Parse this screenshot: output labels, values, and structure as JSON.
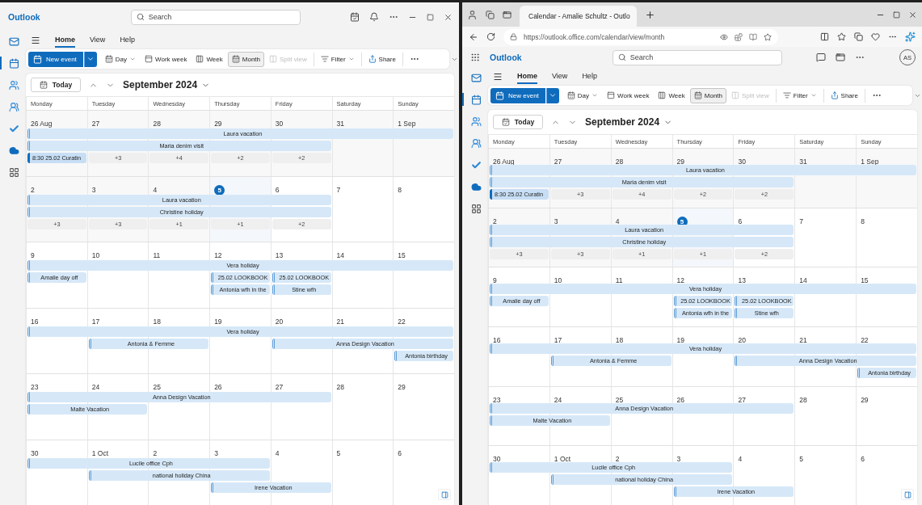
{
  "windows": [
    {
      "kind": "desktop",
      "app": "Outlook",
      "search": {
        "placeholder": "Search"
      },
      "rail": [
        {
          "kind": "mail",
          "selected": false
        },
        {
          "kind": "calendar",
          "selected": true
        },
        {
          "kind": "people",
          "selected": false
        },
        {
          "kind": "groups",
          "selected": false
        },
        {
          "kind": "todo",
          "selected": false
        },
        {
          "kind": "cloud",
          "selected": false
        },
        {
          "kind": "apps",
          "selected": false
        }
      ],
      "ribbon_tabs": [
        {
          "label": "Home",
          "selected": true
        },
        {
          "label": "View",
          "selected": false
        },
        {
          "label": "Help",
          "selected": false
        }
      ],
      "new_event": {
        "label": "New event"
      },
      "views": [
        {
          "kind": "day",
          "label": "Day",
          "selected": false
        },
        {
          "kind": "workweek",
          "label": "Work week",
          "selected": false
        },
        {
          "kind": "week",
          "label": "Week",
          "selected": false
        },
        {
          "kind": "month",
          "label": "Month",
          "selected": true
        }
      ],
      "actions": [
        {
          "kind": "split",
          "label": "Split view",
          "disabled": true
        },
        {
          "kind": "filter",
          "label": "Filter",
          "disabled": false
        },
        {
          "kind": "share",
          "label": "Share",
          "disabled": false
        }
      ],
      "calendar": {
        "today_button": "Today",
        "month": "September 2024",
        "weekdays": [
          "Monday",
          "Tuesday",
          "Wednesday",
          "Thursday",
          "Friday",
          "Saturday",
          "Sunday"
        ],
        "weeks": [
          {
            "days": [
              {
                "label": "26 Aug",
                "past": true,
                "today": false
              },
              {
                "label": "27",
                "past": true,
                "today": false
              },
              {
                "label": "28",
                "past": true,
                "today": false
              },
              {
                "label": "29",
                "past": true,
                "today": false
              },
              {
                "label": "30",
                "past": true,
                "today": false
              },
              {
                "label": "31",
                "past": true,
                "today": false
              },
              {
                "label": "1 Sep",
                "past": true,
                "today": false
              }
            ],
            "lanes": [
              [
                {
                  "kind": "allday",
                  "title": "Laura vacation"
                },
                {
                  "kind": "cont"
                },
                {
                  "kind": "cont"
                },
                {
                  "kind": "cont"
                },
                {
                  "kind": "cont"
                },
                {
                  "kind": "cont"
                },
                {
                  "kind": "cont"
                }
              ],
              [
                {
                  "kind": "allday",
                  "title": "Maria denim visit"
                },
                {
                  "kind": "cont"
                },
                {
                  "kind": "cont"
                },
                {
                  "kind": "cont"
                },
                {
                  "kind": "cont"
                }
              ],
              [
                {
                  "kind": "timed",
                  "title": "8:30 25.02 Curatin"
                },
                {
                  "kind": "more",
                  "title": "+3"
                },
                {
                  "kind": "more",
                  "title": "+4"
                },
                {
                  "kind": "more",
                  "title": "+2"
                },
                {
                  "kind": "more",
                  "title": "+2"
                }
              ]
            ]
          },
          {
            "days": [
              {
                "label": "2",
                "past": true,
                "today": false
              },
              {
                "label": "3",
                "past": true,
                "today": false
              },
              {
                "label": "4",
                "past": true,
                "today": false
              },
              {
                "label": "5",
                "past": false,
                "today": true
              },
              {
                "label": "6",
                "past": false,
                "today": false
              },
              {
                "label": "7",
                "past": false,
                "today": false
              },
              {
                "label": "8",
                "past": false,
                "today": false
              }
            ],
            "lanes": [
              [
                {
                  "kind": "allday",
                  "title": "Laura vacation"
                },
                {
                  "kind": "cont"
                },
                {
                  "kind": "cont"
                },
                {
                  "kind": "cont"
                },
                {
                  "kind": "cont"
                }
              ],
              [
                {
                  "kind": "allday",
                  "title": "Christine holiday"
                },
                {
                  "kind": "cont"
                },
                {
                  "kind": "cont"
                },
                {
                  "kind": "cont"
                },
                {
                  "kind": "cont"
                }
              ],
              [
                {
                  "kind": "more",
                  "title": "+3"
                },
                {
                  "kind": "more",
                  "title": "+3"
                },
                {
                  "kind": "more",
                  "title": "+1"
                },
                {
                  "kind": "more",
                  "title": "+1"
                },
                {
                  "kind": "more",
                  "title": "+2"
                }
              ]
            ]
          },
          {
            "days": [
              {
                "label": "9",
                "past": false,
                "today": false
              },
              {
                "label": "10",
                "past": false,
                "today": false
              },
              {
                "label": "11",
                "past": false,
                "today": false
              },
              {
                "label": "12",
                "past": false,
                "today": false
              },
              {
                "label": "13",
                "past": false,
                "today": false
              },
              {
                "label": "14",
                "past": false,
                "today": false
              },
              {
                "label": "15",
                "past": false,
                "today": false
              }
            ],
            "lanes": [
              [
                {
                  "kind": "allday",
                  "title": "Vera holiday"
                },
                {
                  "kind": "cont"
                },
                {
                  "kind": "cont"
                },
                {
                  "kind": "cont"
                },
                {
                  "kind": "cont"
                },
                {
                  "kind": "cont"
                },
                {
                  "kind": "cont"
                }
              ],
              [
                {
                  "kind": "allday",
                  "title": "Amalie day off"
                },
                {
                  "kind": "empty"
                },
                {
                  "kind": "empty"
                },
                {
                  "kind": "allday",
                  "title": "25.02 LOOKBOOK"
                },
                {
                  "kind": "allday",
                  "title": "25.02 LOOKBOOK"
                }
              ],
              [
                {
                  "kind": "empty"
                },
                {
                  "kind": "empty"
                },
                {
                  "kind": "empty"
                },
                {
                  "kind": "allday",
                  "title": "Antonia wfh in the"
                },
                {
                  "kind": "allday",
                  "title": "Stine wfh"
                }
              ]
            ]
          },
          {
            "days": [
              {
                "label": "16",
                "past": false,
                "today": false
              },
              {
                "label": "17",
                "past": false,
                "today": false
              },
              {
                "label": "18",
                "past": false,
                "today": false
              },
              {
                "label": "19",
                "past": false,
                "today": false
              },
              {
                "label": "20",
                "past": false,
                "today": false
              },
              {
                "label": "21",
                "past": false,
                "today": false
              },
              {
                "label": "22",
                "past": false,
                "today": false
              }
            ],
            "lanes": [
              [
                {
                  "kind": "allday",
                  "title": "Vera holiday"
                },
                {
                  "kind": "cont"
                },
                {
                  "kind": "cont"
                },
                {
                  "kind": "cont"
                },
                {
                  "kind": "cont"
                },
                {
                  "kind": "cont"
                },
                {
                  "kind": "cont"
                }
              ],
              [
                {
                  "kind": "empty"
                },
                {
                  "kind": "allday",
                  "title": "Antonia & Femme"
                },
                {
                  "kind": "cont"
                },
                {
                  "kind": "empty"
                },
                {
                  "kind": "allday",
                  "title": "Anna Design Vacation"
                },
                {
                  "kind": "cont"
                },
                {
                  "kind": "cont"
                }
              ],
              [
                {
                  "kind": "empty"
                },
                {
                  "kind": "empty"
                },
                {
                  "kind": "empty"
                },
                {
                  "kind": "empty"
                },
                {
                  "kind": "empty"
                },
                {
                  "kind": "empty"
                },
                {
                  "kind": "allday",
                  "title": "Antonia birthday"
                }
              ]
            ]
          },
          {
            "days": [
              {
                "label": "23",
                "past": false,
                "today": false
              },
              {
                "label": "24",
                "past": false,
                "today": false
              },
              {
                "label": "25",
                "past": false,
                "today": false
              },
              {
                "label": "26",
                "past": false,
                "today": false
              },
              {
                "label": "27",
                "past": false,
                "today": false
              },
              {
                "label": "28",
                "past": false,
                "today": false
              },
              {
                "label": "29",
                "past": false,
                "today": false
              }
            ],
            "lanes": [
              [
                {
                  "kind": "allday",
                  "title": "Anna Design Vacation"
                },
                {
                  "kind": "cont"
                },
                {
                  "kind": "cont"
                },
                {
                  "kind": "cont"
                },
                {
                  "kind": "cont"
                }
              ],
              [
                {
                  "kind": "allday",
                  "title": "Malte Vacation"
                },
                {
                  "kind": "cont"
                }
              ]
            ]
          },
          {
            "days": [
              {
                "label": "30",
                "past": false,
                "today": false
              },
              {
                "label": "1 Oct",
                "past": false,
                "today": false
              },
              {
                "label": "2",
                "past": false,
                "today": false
              },
              {
                "label": "3",
                "past": false,
                "today": false
              },
              {
                "label": "4",
                "past": false,
                "today": false
              },
              {
                "label": "5",
                "past": false,
                "today": false
              },
              {
                "label": "6",
                "past": false,
                "today": false
              }
            ],
            "lanes": [
              [
                {
                  "kind": "allday",
                  "title": "Lucile office Cph"
                },
                {
                  "kind": "cont"
                },
                {
                  "kind": "cont"
                },
                {
                  "kind": "cont"
                }
              ],
              [
                {
                  "kind": "empty"
                },
                {
                  "kind": "allday",
                  "title": "national holiday China"
                },
                {
                  "kind": "cont"
                },
                {
                  "kind": "cont"
                }
              ],
              [
                {
                  "kind": "empty"
                },
                {
                  "kind": "empty"
                },
                {
                  "kind": "empty"
                },
                {
                  "kind": "allday",
                  "title": "Irene Vacation"
                },
                {
                  "kind": "cont"
                }
              ]
            ]
          }
        ]
      }
    },
    {
      "kind": "browser",
      "browser_tab": {
        "title": "Calendar - Amalie Schultz - Outlo"
      },
      "address": "https://outlook.office.com/calendar/view/month",
      "app": "Outlook",
      "avatar": "AS",
      "search": {
        "placeholder": "Search"
      },
      "rail": [
        {
          "kind": "mail",
          "selected": false
        },
        {
          "kind": "calendar",
          "selected": true
        },
        {
          "kind": "people",
          "selected": false
        },
        {
          "kind": "groups",
          "selected": false
        },
        {
          "kind": "todo",
          "selected": false
        },
        {
          "kind": "cloud",
          "selected": false
        },
        {
          "kind": "apps",
          "selected": false
        }
      ],
      "ribbon_tabs": [
        {
          "label": "Home",
          "selected": true
        },
        {
          "label": "View",
          "selected": false
        },
        {
          "label": "Help",
          "selected": false
        }
      ],
      "new_event": {
        "label": "New event"
      },
      "views": [
        {
          "kind": "day",
          "label": "Day",
          "selected": false
        },
        {
          "kind": "workweek",
          "label": "Work week",
          "selected": false
        },
        {
          "kind": "week",
          "label": "Week",
          "selected": false
        },
        {
          "kind": "month",
          "label": "Month",
          "selected": true
        }
      ],
      "actions": [
        {
          "kind": "split",
          "label": "Split view",
          "disabled": true
        },
        {
          "kind": "filter",
          "label": "Filter",
          "disabled": false
        },
        {
          "kind": "share",
          "label": "Share",
          "disabled": false
        }
      ],
      "calendar": {
        "today_button": "Today",
        "month": "September 2024",
        "weekdays": [
          "Monday",
          "Tuesday",
          "Wednesday",
          "Thursday",
          "Friday",
          "Saturday",
          "Sunday"
        ],
        "weeks": [
          {
            "days": [
              {
                "label": "26 Aug",
                "past": true,
                "today": false
              },
              {
                "label": "27",
                "past": true,
                "today": false
              },
              {
                "label": "28",
                "past": true,
                "today": false
              },
              {
                "label": "29",
                "past": true,
                "today": false
              },
              {
                "label": "30",
                "past": true,
                "today": false
              },
              {
                "label": "31",
                "past": true,
                "today": false
              },
              {
                "label": "1 Sep",
                "past": true,
                "today": false
              }
            ],
            "lanes": [
              [
                {
                  "kind": "allday",
                  "title": "Laura vacation"
                },
                {
                  "kind": "cont"
                },
                {
                  "kind": "cont"
                },
                {
                  "kind": "cont"
                },
                {
                  "kind": "cont"
                },
                {
                  "kind": "cont"
                },
                {
                  "kind": "cont"
                }
              ],
              [
                {
                  "kind": "allday",
                  "title": "Maria denim visit"
                },
                {
                  "kind": "cont"
                },
                {
                  "kind": "cont"
                },
                {
                  "kind": "cont"
                },
                {
                  "kind": "cont"
                }
              ],
              [
                {
                  "kind": "timed",
                  "title": "8:30 25.02 Curatin"
                },
                {
                  "kind": "more",
                  "title": "+3"
                },
                {
                  "kind": "more",
                  "title": "+4"
                },
                {
                  "kind": "more",
                  "title": "+2"
                },
                {
                  "kind": "more",
                  "title": "+2"
                }
              ]
            ]
          },
          {
            "days": [
              {
                "label": "2",
                "past": true,
                "today": false
              },
              {
                "label": "3",
                "past": true,
                "today": false
              },
              {
                "label": "4",
                "past": true,
                "today": false
              },
              {
                "label": "5",
                "past": false,
                "today": true
              },
              {
                "label": "6",
                "past": false,
                "today": false
              },
              {
                "label": "7",
                "past": false,
                "today": false
              },
              {
                "label": "8",
                "past": false,
                "today": false
              }
            ],
            "lanes": [
              [
                {
                  "kind": "allday",
                  "title": "Laura vacation"
                },
                {
                  "kind": "cont"
                },
                {
                  "kind": "cont"
                },
                {
                  "kind": "cont"
                },
                {
                  "kind": "cont"
                }
              ],
              [
                {
                  "kind": "allday",
                  "title": "Christine holiday"
                },
                {
                  "kind": "cont"
                },
                {
                  "kind": "cont"
                },
                {
                  "kind": "cont"
                },
                {
                  "kind": "cont"
                }
              ],
              [
                {
                  "kind": "more",
                  "title": "+3"
                },
                {
                  "kind": "more",
                  "title": "+3"
                },
                {
                  "kind": "more",
                  "title": "+1"
                },
                {
                  "kind": "more",
                  "title": "+1"
                },
                {
                  "kind": "more",
                  "title": "+2"
                }
              ]
            ]
          },
          {
            "days": [
              {
                "label": "9",
                "past": false,
                "today": false
              },
              {
                "label": "10",
                "past": false,
                "today": false
              },
              {
                "label": "11",
                "past": false,
                "today": false
              },
              {
                "label": "12",
                "past": false,
                "today": false
              },
              {
                "label": "13",
                "past": false,
                "today": false
              },
              {
                "label": "14",
                "past": false,
                "today": false
              },
              {
                "label": "15",
                "past": false,
                "today": false
              }
            ],
            "lanes": [
              [
                {
                  "kind": "allday",
                  "title": "Vera holiday"
                },
                {
                  "kind": "cont"
                },
                {
                  "kind": "cont"
                },
                {
                  "kind": "cont"
                },
                {
                  "kind": "cont"
                },
                {
                  "kind": "cont"
                },
                {
                  "kind": "cont"
                }
              ],
              [
                {
                  "kind": "allday",
                  "title": "Amalie day off"
                },
                {
                  "kind": "empty"
                },
                {
                  "kind": "empty"
                },
                {
                  "kind": "allday",
                  "title": "25.02 LOOKBOOK"
                },
                {
                  "kind": "allday",
                  "title": "25.02 LOOKBOOK"
                }
              ],
              [
                {
                  "kind": "empty"
                },
                {
                  "kind": "empty"
                },
                {
                  "kind": "empty"
                },
                {
                  "kind": "allday",
                  "title": "Antonia wfh in the"
                },
                {
                  "kind": "allday",
                  "title": "Stine wfh"
                }
              ]
            ]
          },
          {
            "days": [
              {
                "label": "16",
                "past": false,
                "today": false
              },
              {
                "label": "17",
                "past": false,
                "today": false
              },
              {
                "label": "18",
                "past": false,
                "today": false
              },
              {
                "label": "19",
                "past": false,
                "today": false
              },
              {
                "label": "20",
                "past": false,
                "today": false
              },
              {
                "label": "21",
                "past": false,
                "today": false
              },
              {
                "label": "22",
                "past": false,
                "today": false
              }
            ],
            "lanes": [
              [
                {
                  "kind": "allday",
                  "title": "Vera holiday"
                },
                {
                  "kind": "cont"
                },
                {
                  "kind": "cont"
                },
                {
                  "kind": "cont"
                },
                {
                  "kind": "cont"
                },
                {
                  "kind": "cont"
                },
                {
                  "kind": "cont"
                }
              ],
              [
                {
                  "kind": "empty"
                },
                {
                  "kind": "allday",
                  "title": "Antonia & Femme"
                },
                {
                  "kind": "cont"
                },
                {
                  "kind": "empty"
                },
                {
                  "kind": "allday",
                  "title": "Anna Design Vacation"
                },
                {
                  "kind": "cont"
                },
                {
                  "kind": "cont"
                }
              ],
              [
                {
                  "kind": "empty"
                },
                {
                  "kind": "empty"
                },
                {
                  "kind": "empty"
                },
                {
                  "kind": "empty"
                },
                {
                  "kind": "empty"
                },
                {
                  "kind": "empty"
                },
                {
                  "kind": "allday",
                  "title": "Antonia birthday"
                }
              ]
            ]
          },
          {
            "days": [
              {
                "label": "23",
                "past": false,
                "today": false
              },
              {
                "label": "24",
                "past": false,
                "today": false
              },
              {
                "label": "25",
                "past": false,
                "today": false
              },
              {
                "label": "26",
                "past": false,
                "today": false
              },
              {
                "label": "27",
                "past": false,
                "today": false
              },
              {
                "label": "28",
                "past": false,
                "today": false
              },
              {
                "label": "29",
                "past": false,
                "today": false
              }
            ],
            "lanes": [
              [
                {
                  "kind": "allday",
                  "title": "Anna Design Vacation"
                },
                {
                  "kind": "cont"
                },
                {
                  "kind": "cont"
                },
                {
                  "kind": "cont"
                },
                {
                  "kind": "cont"
                }
              ],
              [
                {
                  "kind": "allday",
                  "title": "Malte Vacation"
                },
                {
                  "kind": "cont"
                }
              ]
            ]
          },
          {
            "days": [
              {
                "label": "30",
                "past": false,
                "today": false
              },
              {
                "label": "1 Oct",
                "past": false,
                "today": false
              },
              {
                "label": "2",
                "past": false,
                "today": false
              },
              {
                "label": "3",
                "past": false,
                "today": false
              },
              {
                "label": "4",
                "past": false,
                "today": false
              },
              {
                "label": "5",
                "past": false,
                "today": false
              },
              {
                "label": "6",
                "past": false,
                "today": false
              }
            ],
            "lanes": [
              [
                {
                  "kind": "allday",
                  "title": "Lucile office Cph"
                },
                {
                  "kind": "cont"
                },
                {
                  "kind": "cont"
                },
                {
                  "kind": "cont"
                }
              ],
              [
                {
                  "kind": "empty"
                },
                {
                  "kind": "allday",
                  "title": "national holiday China"
                },
                {
                  "kind": "cont"
                },
                {
                  "kind": "cont"
                }
              ],
              [
                {
                  "kind": "empty"
                },
                {
                  "kind": "empty"
                },
                {
                  "kind": "empty"
                },
                {
                  "kind": "allday",
                  "title": "Irene Vacation"
                },
                {
                  "kind": "cont"
                }
              ]
            ]
          }
        ]
      }
    }
  ]
}
